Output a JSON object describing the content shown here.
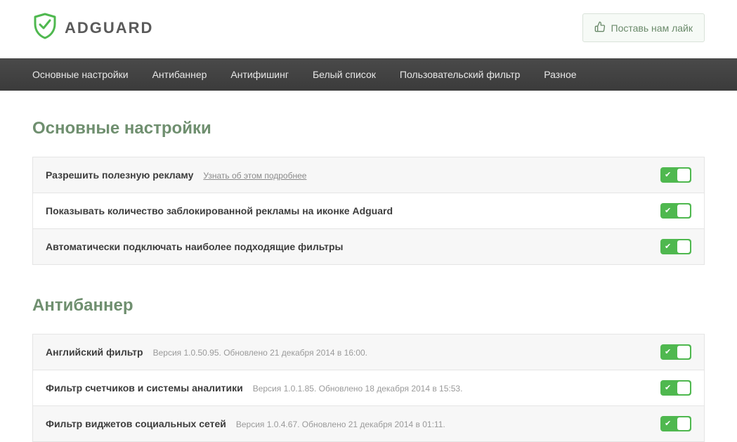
{
  "header": {
    "brand": "ADGUARD",
    "like_label": "Поставь нам лайк"
  },
  "nav": {
    "items": [
      "Основные настройки",
      "Антибаннер",
      "Антифишинг",
      "Белый список",
      "Пользовательский фильтр",
      "Разное"
    ]
  },
  "sections": {
    "general": {
      "title": "Основные настройки",
      "rows": [
        {
          "label": "Разрешить полезную рекламу",
          "link": "Узнать об этом подробнее",
          "on": true
        },
        {
          "label": "Показывать количество заблокированной рекламы на иконке Adguard",
          "on": true
        },
        {
          "label": "Автоматически подключать наиболее подходящие фильтры",
          "on": true
        }
      ]
    },
    "antibanner": {
      "title": "Антибаннер",
      "rows": [
        {
          "label": "Английский фильтр",
          "sub": "Версия 1.0.50.95. Обновлено 21 декабря 2014 в 16:00.",
          "on": true
        },
        {
          "label": "Фильтр счетчиков и системы аналитики",
          "sub": "Версия 1.0.1.85. Обновлено 18 декабря 2014 в 15:53.",
          "on": true
        },
        {
          "label": "Фильтр виджетов социальных сетей",
          "sub": "Версия 1.0.4.67. Обновлено 21 декабря 2014 в 01:11.",
          "on": true
        }
      ]
    }
  },
  "colors": {
    "accent": "#4fb84f",
    "heading": "#6f8f6f"
  }
}
